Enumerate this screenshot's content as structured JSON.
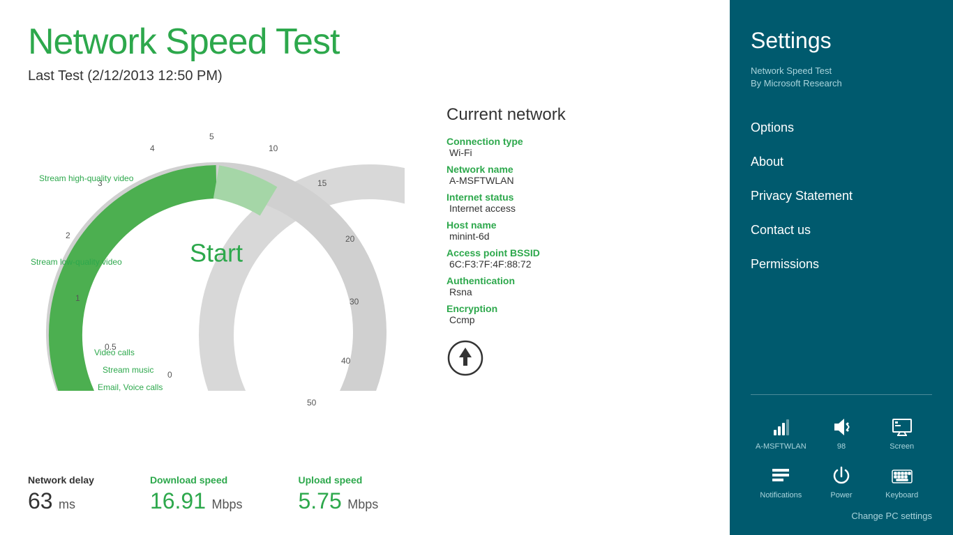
{
  "app": {
    "title": "Network Speed Test",
    "last_test": "Last Test (2/12/2013 12:50 PM)"
  },
  "gauge": {
    "start_label": "Start",
    "scale_labels": [
      "0",
      "0.5",
      "1",
      "2",
      "3",
      "4",
      "5",
      "10",
      "15",
      "20",
      "30",
      "40",
      "50"
    ],
    "annotations": [
      {
        "label": "Stream high-quality video",
        "value": "3"
      },
      {
        "label": "Stream low-quality video",
        "value": "2"
      },
      {
        "label": "Video calls",
        "value": "0.5"
      },
      {
        "label": "Stream music",
        "value": ""
      },
      {
        "label": "Email, Voice calls",
        "value": ""
      }
    ]
  },
  "network": {
    "title": "Current network",
    "fields": [
      {
        "label": "Connection type",
        "value": "Wi-Fi"
      },
      {
        "label": "Network name",
        "value": "A-MSFTWLAN"
      },
      {
        "label": "Internet status",
        "value": "Internet access"
      },
      {
        "label": "Host name",
        "value": "minint-6d"
      },
      {
        "label": "Access point BSSID",
        "value": "6C:F3:7F:4F:88:72"
      },
      {
        "label": "Authentication",
        "value": "Rsna"
      },
      {
        "label": "Encryption",
        "value": "Ccmp"
      }
    ]
  },
  "stats": {
    "delay_label": "Network delay",
    "delay_value": "63",
    "delay_unit": "ms",
    "download_label": "Download speed",
    "download_value": "16.91",
    "download_unit": "Mbps",
    "upload_label": "Upload speed",
    "upload_value": "5.75",
    "upload_unit": "Mbps"
  },
  "settings": {
    "title": "Settings",
    "app_name": "Network Speed Test",
    "app_author": "By Microsoft Research",
    "menu_items": [
      "Options",
      "About",
      "Privacy Statement",
      "Contact us",
      "Permissions"
    ],
    "system_icons_row1": [
      {
        "label": "A-MSFTWLAN",
        "icon": "wifi"
      },
      {
        "label": "98",
        "icon": "volume"
      },
      {
        "label": "Screen",
        "icon": "screen"
      }
    ],
    "system_icons_row2": [
      {
        "label": "Notifications",
        "icon": "notifications"
      },
      {
        "label": "Power",
        "icon": "power"
      },
      {
        "label": "Keyboard",
        "icon": "keyboard"
      }
    ],
    "change_pc_settings": "Change PC settings"
  }
}
